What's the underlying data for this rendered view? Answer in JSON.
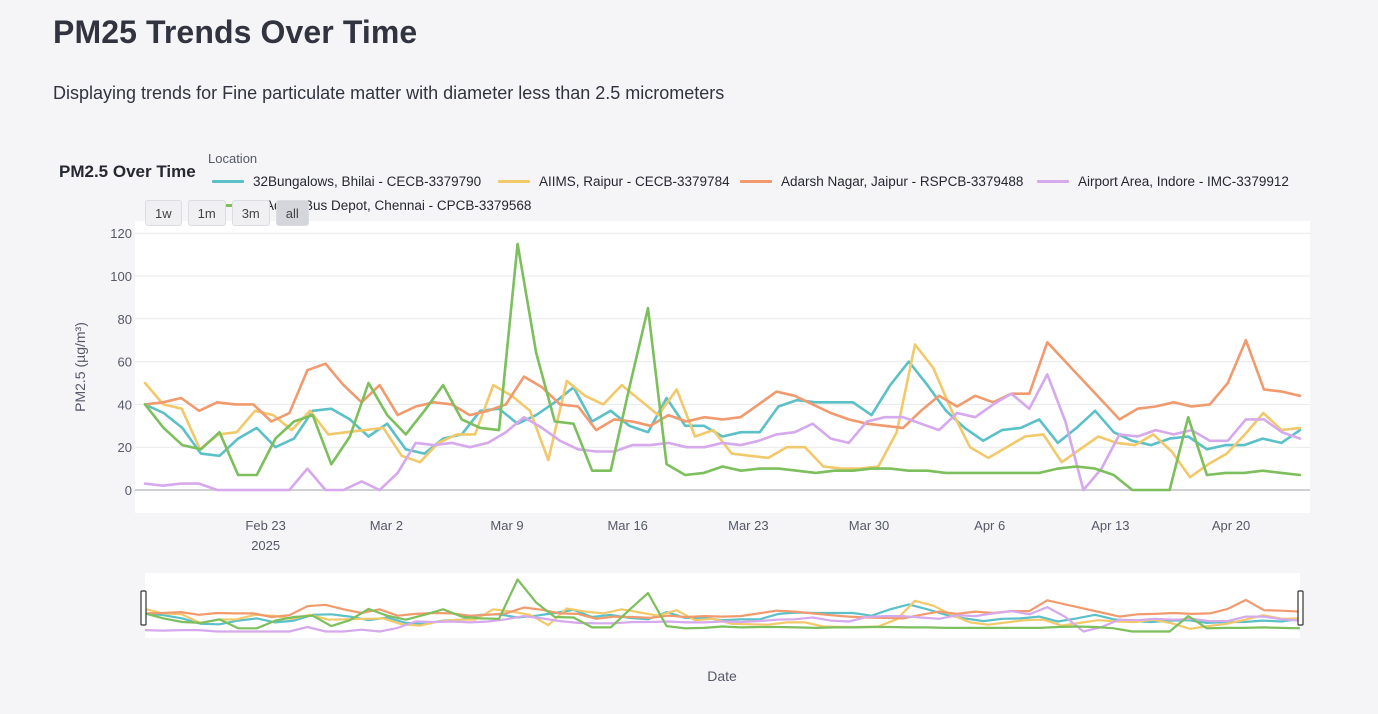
{
  "page": {
    "title": "PM25 Trends Over Time",
    "subtitle": "Displaying trends for Fine particulate matter with diameter less than 2.5 micrometers"
  },
  "legend": {
    "heading": "Location"
  },
  "range_buttons": [
    "1w",
    "1m",
    "3m",
    "all"
  ],
  "range_selected": "all",
  "colors": {
    "32Bungalows": "#5bc0c8",
    "AIIMS": "#f2c96a",
    "Adarsh": "#f09a6e",
    "Airport": "#d6a8ec",
    "Chennai": "#7cbf5c"
  },
  "chart_data": {
    "type": "line",
    "title": "PM2.5 Over Time",
    "xlabel": "Date",
    "ylabel": "PM2.5 (µg/m³)",
    "ylim": [
      -10,
      125
    ],
    "yticks": [
      0,
      20,
      40,
      60,
      80,
      100,
      120
    ],
    "x_start_date": "2025-02-16",
    "x_end_date": "2025-04-24",
    "xticks": [
      {
        "date": "2025-02-23",
        "label": "Feb 23",
        "sub": "2025"
      },
      {
        "date": "2025-03-02",
        "label": "Mar 2"
      },
      {
        "date": "2025-03-09",
        "label": "Mar 9"
      },
      {
        "date": "2025-03-16",
        "label": "Mar 16"
      },
      {
        "date": "2025-03-23",
        "label": "Mar 23"
      },
      {
        "date": "2025-03-30",
        "label": "Mar 30"
      },
      {
        "date": "2025-04-06",
        "label": "Apr 6"
      },
      {
        "date": "2025-04-13",
        "label": "Apr 13"
      },
      {
        "date": "2025-04-20",
        "label": "Apr 20"
      }
    ],
    "grid": true,
    "legend_position": "top",
    "rangeslider": true,
    "series": [
      {
        "name": "32Bungalows, Bhilai - CECB-3379790",
        "color": "#5bc0c8",
        "values": [
          40,
          36,
          29,
          17,
          16,
          24,
          29,
          20,
          24,
          37,
          38,
          33,
          25,
          31,
          19,
          17,
          24,
          26,
          37,
          38,
          31,
          35,
          41,
          48,
          32,
          37,
          30,
          27,
          43,
          30,
          30,
          25,
          27,
          27,
          39,
          42,
          41,
          41,
          41,
          35,
          49,
          60,
          49,
          37,
          29,
          23,
          28,
          29,
          33,
          22,
          29,
          37,
          27,
          23,
          21,
          24,
          25,
          19,
          21,
          21,
          24,
          22,
          28
        ]
      },
      {
        "name": "AIIMS, Raipur - CECB-3379784",
        "color": "#f2c96a",
        "values": [
          50,
          40,
          38,
          19,
          26,
          27,
          37,
          35,
          28,
          37,
          26,
          27,
          28,
          29,
          16,
          13,
          22,
          26,
          26,
          49,
          44,
          37,
          14,
          51,
          44,
          40,
          49,
          42,
          35,
          47,
          25,
          28,
          17,
          16,
          15,
          20,
          20,
          11,
          10,
          10,
          11,
          27,
          68,
          57,
          37,
          20,
          15,
          20,
          25,
          26,
          13,
          19,
          25,
          22,
          21,
          26,
          18,
          6,
          12,
          17,
          26,
          36,
          28,
          29
        ]
      },
      {
        "name": "Adarsh Nagar, Jaipur - RSPCB-3379488",
        "color": "#f09a6e",
        "values": [
          40,
          41,
          43,
          37,
          41,
          40,
          40,
          32,
          36,
          56,
          59,
          49,
          41,
          49,
          35,
          39,
          41,
          40,
          35,
          37,
          40,
          53,
          48,
          40,
          39,
          28,
          33,
          32,
          30,
          35,
          32,
          34,
          33,
          34,
          40,
          46,
          44,
          40,
          36,
          33,
          31,
          30,
          29,
          37,
          44,
          39,
          44,
          41,
          45,
          45,
          69,
          60,
          51,
          42,
          33,
          38,
          39,
          41,
          39,
          40,
          50,
          70,
          47,
          46,
          44
        ]
      },
      {
        "name": "Airport Area, Indore - IMC-3379912",
        "color": "#d6a8ec",
        "values": [
          3,
          2,
          3,
          3,
          0,
          0,
          0,
          0,
          0,
          10,
          0,
          0,
          4,
          0,
          8,
          22,
          21,
          22,
          20,
          22,
          27,
          34,
          29,
          23,
          19,
          18,
          18,
          21,
          21,
          22,
          20,
          20,
          22,
          21,
          23,
          26,
          27,
          31,
          24,
          22,
          32,
          34,
          34,
          31,
          28,
          36,
          34,
          40,
          45,
          38,
          54,
          32,
          0,
          10,
          26,
          25,
          28,
          26,
          28,
          23,
          23,
          33,
          33,
          27,
          24
        ]
      },
      {
        "name": "Adyar Bus Depot, Chennai - CPCB-3379568",
        "color": "#7cbf5c",
        "values": [
          40,
          29,
          21,
          19,
          27,
          7,
          7,
          24,
          32,
          35,
          12,
          25,
          50,
          35,
          26,
          37,
          49,
          33,
          29,
          28,
          115,
          64,
          32,
          31,
          9,
          9,
          48,
          85,
          12,
          7,
          8,
          11,
          9,
          10,
          10,
          9,
          8,
          9,
          9,
          10,
          10,
          9,
          9,
          8,
          8,
          8,
          8,
          8,
          8,
          10,
          11,
          10,
          7,
          0,
          0,
          0,
          34,
          7,
          8,
          8,
          9,
          8,
          7
        ]
      }
    ]
  }
}
